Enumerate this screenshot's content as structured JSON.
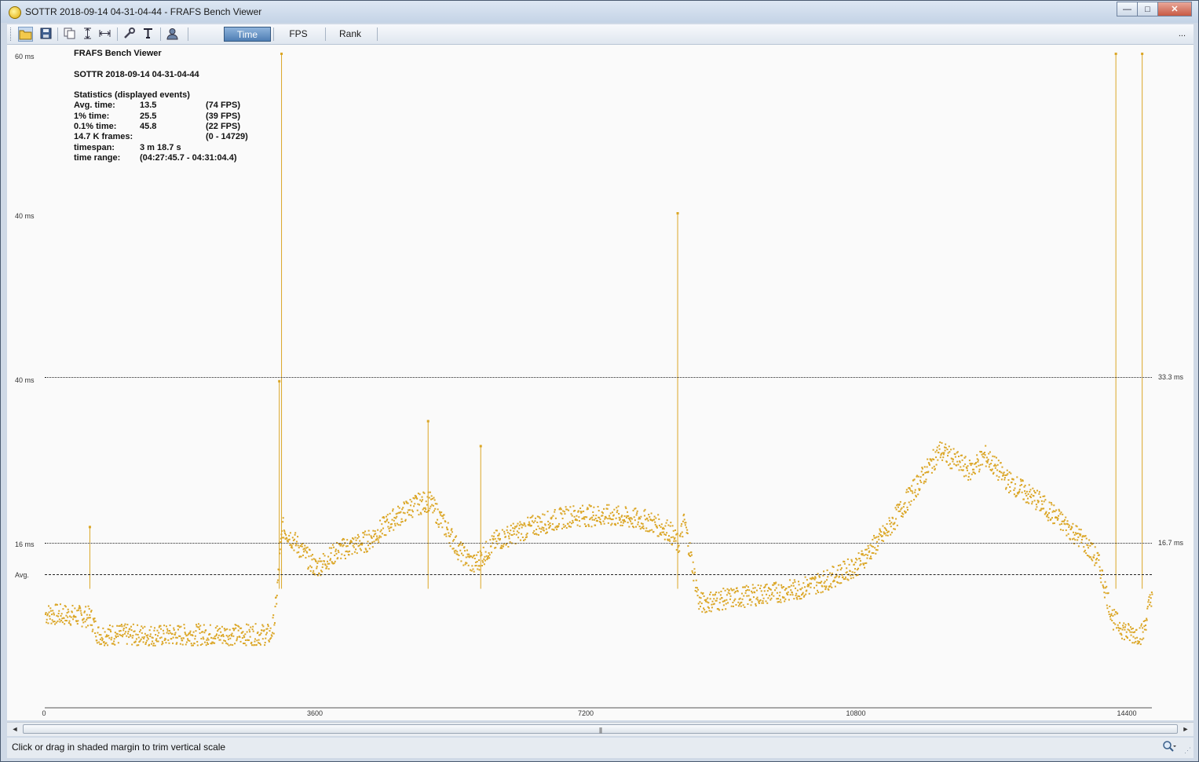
{
  "window": {
    "title": "SOTTR 2018-09-14 04-31-04-44 - FRAFS Bench Viewer",
    "minimize_glyph": "—",
    "maximize_glyph": "□",
    "close_glyph": "✕"
  },
  "toolbar": {
    "icons": [
      "open-folder-icon",
      "save-icon",
      "copy-icon",
      "fit-vertical-icon",
      "fit-horizontal-icon",
      "settings-wrench-icon",
      "text-icon",
      "user-icon"
    ],
    "tabs": [
      {
        "label": "Time",
        "active": true
      },
      {
        "label": "FPS",
        "active": false
      },
      {
        "label": "Rank",
        "active": false
      }
    ],
    "overflow": "..."
  },
  "stats": {
    "app": "FRAFS Bench Viewer",
    "file": "SOTTR 2018-09-14 04-31-04-44",
    "header": "Statistics (displayed events)",
    "rows": [
      {
        "label": "Avg. time:",
        "value": "13.5",
        "extra": "(74 FPS)"
      },
      {
        "label": "1% time:",
        "value": "25.5",
        "extra": "(39 FPS)"
      },
      {
        "label": "0.1% time:",
        "value": "45.8",
        "extra": "(22 FPS)"
      },
      {
        "label": "14.7 K frames:",
        "value": "",
        "extra": "(0 - 14729)"
      },
      {
        "label": "timespan:",
        "value": "3 m 18.7 s",
        "extra": ""
      },
      {
        "label": "time range:",
        "value": "(04:27:45.7 - 04:31:04.4)",
        "extra": ""
      }
    ]
  },
  "chart_data": {
    "type": "scatter",
    "x_ticks": [
      "0",
      "3600",
      "7200",
      "10800",
      "14400"
    ],
    "y_ticks_left": [
      "60 ms",
      "40 ms",
      "40 ms",
      "16 ms"
    ],
    "y_ticks_right": [
      "33.3 ms",
      "16.7 ms"
    ],
    "avg_label": "Avg.",
    "reference_lines": [
      {
        "label": "33.3 ms",
        "value": 33.3,
        "style": "dotted"
      },
      {
        "label": "16.7 ms",
        "value": 16.7,
        "style": "dotted"
      },
      {
        "label": "Avg.",
        "value": 13.5,
        "style": "dashed"
      }
    ],
    "xlim": [
      0,
      14729
    ],
    "color": "#dba626",
    "series": [
      {
        "x": [
          0,
          300,
          600,
          700,
          1000,
          1500,
          2000,
          2500,
          3000,
          3050,
          3150,
          3300,
          3600,
          3900,
          4300,
          4600,
          4900,
          5100,
          5350,
          5500,
          5700,
          6000,
          6500,
          7000,
          7500,
          8000,
          8300,
          8420,
          8500,
          8700,
          9000,
          9500,
          10000,
          10400,
          10800,
          11200,
          11500,
          11900,
          12100,
          12300,
          12500,
          12800,
          13200,
          13500,
          13800,
          14000,
          14200,
          14400,
          14600,
          14729
        ],
        "y": [
          9.5,
          9.4,
          9.2,
          7.4,
          7.4,
          7.3,
          7.4,
          7.4,
          7.4,
          9.0,
          18.3,
          17.0,
          14.2,
          16.0,
          17.0,
          19.0,
          20.5,
          21.0,
          18.0,
          16.0,
          14.5,
          17.0,
          18.5,
          19.5,
          19.5,
          19.0,
          18.0,
          16.5,
          19.0,
          10.6,
          11.0,
          11.5,
          12.0,
          13.0,
          14.5,
          18.0,
          21.5,
          26.0,
          25.0,
          24.0,
          25.5,
          23.0,
          21.0,
          19.0,
          17.0,
          15.0,
          9.0,
          7.5,
          7.5,
          12.0
        ]
      }
    ],
    "spikes": [
      {
        "x": 600,
        "y": 18.4
      },
      {
        "x": 3150,
        "y": 60
      },
      {
        "x": 3120,
        "y": 33.0
      },
      {
        "x": 5100,
        "y": 29.0
      },
      {
        "x": 5800,
        "y": 26.5
      },
      {
        "x": 8420,
        "y": 45.0
      },
      {
        "x": 14250,
        "y": 60
      },
      {
        "x": 14600,
        "y": 60
      }
    ]
  },
  "status": {
    "text": "Click or drag in shaded margin to trim vertical scale",
    "zoom_icon": "magnifier-icon"
  },
  "scrollbar": {
    "left_arrow": "◄",
    "right_arrow": "►",
    "grip": "|||"
  }
}
